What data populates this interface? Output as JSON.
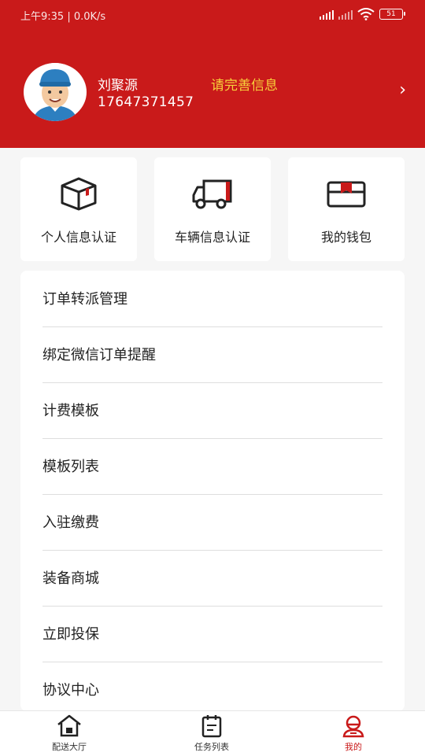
{
  "status_bar": {
    "time_speed": "上午9:35 | 0.0K/s",
    "battery": "51"
  },
  "profile": {
    "name": "刘聚源",
    "phone": "17647371457",
    "complete_info": "请完善信息",
    "chevron": "›"
  },
  "cards": [
    {
      "label": "个人信息认证",
      "icon": "box-icon"
    },
    {
      "label": "车辆信息认证",
      "icon": "truck-icon"
    },
    {
      "label": "我的钱包",
      "icon": "wallet-icon"
    }
  ],
  "menu": [
    "订单转派管理",
    "绑定微信订单提醒",
    "计费模板",
    "模板列表",
    "入驻缴费",
    "装备商城",
    "立即投保",
    "协议中心"
  ],
  "tabs": [
    {
      "label": "配送大厅",
      "icon": "home-icon"
    },
    {
      "label": "任务列表",
      "icon": "task-list-icon"
    },
    {
      "label": "我的",
      "icon": "profile-icon"
    }
  ],
  "colors": {
    "brand_red": "#c91a1a",
    "highlight_yellow": "#f7d13a"
  }
}
